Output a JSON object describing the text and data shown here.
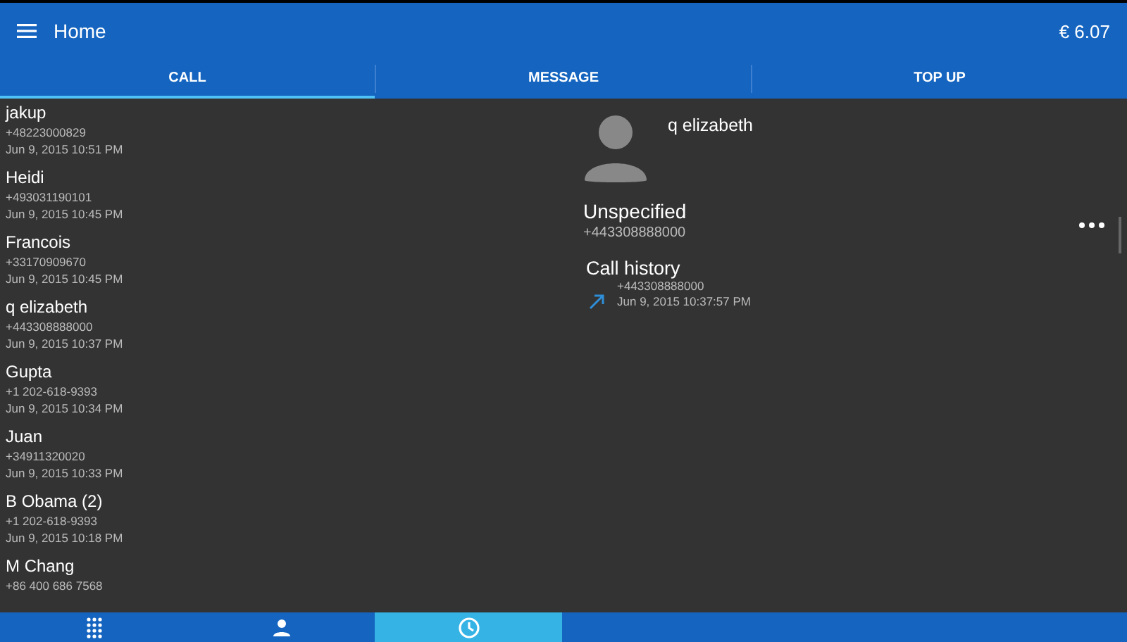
{
  "app_bar": {
    "title": "Home",
    "balance": "€ 6.07"
  },
  "tabs": [
    {
      "label": "CALL",
      "selected": true
    },
    {
      "label": "MESSAGE",
      "selected": false
    },
    {
      "label": "TOP UP",
      "selected": false
    }
  ],
  "calls": [
    {
      "name": "jakup",
      "number": "+48223000829",
      "time": "Jun 9, 2015 10:51 PM"
    },
    {
      "name": "Heidi",
      "number": "+493031190101",
      "time": "Jun 9, 2015 10:45 PM"
    },
    {
      "name": "Francois",
      "number": "+33170909670",
      "time": "Jun 9, 2015 10:45 PM"
    },
    {
      "name": "q elizabeth",
      "number": "+443308888000",
      "time": "Jun 9, 2015 10:37 PM"
    },
    {
      "name": "Gupta",
      "number": "+1 202-618-9393",
      "time": "Jun 9, 2015 10:34 PM"
    },
    {
      "name": "Juan",
      "number": "+34911320020",
      "time": "Jun 9, 2015 10:33 PM"
    },
    {
      "name": "B Obama  (2)",
      "number": "+1 202-618-9393",
      "time": "Jun 9, 2015 10:18 PM"
    },
    {
      "name": "M Chang",
      "number": "+86 400 686 7568"
    }
  ],
  "detail": {
    "name": "q elizabeth",
    "label": "Unspecified",
    "number": "+443308888000",
    "history_title": "Call history",
    "history": [
      {
        "kind": "outgoing",
        "number": "+443308888000",
        "time": "Jun 9, 2015 10:37:57 PM"
      }
    ]
  },
  "bottom_nav": [
    {
      "kind": "dialpad",
      "selected": false
    },
    {
      "kind": "contacts",
      "selected": false
    },
    {
      "kind": "history",
      "selected": true
    }
  ]
}
